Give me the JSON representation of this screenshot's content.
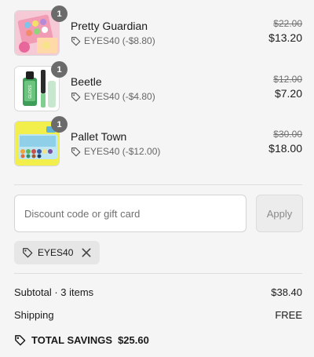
{
  "items": [
    {
      "name": "Pretty Guardian",
      "quantity": "1",
      "discount": "EYES40 (-$8.80)",
      "original_price": "$22.00",
      "final_price": "$13.20",
      "thumb_icon": "eyeshadow-palette-pink"
    },
    {
      "name": "Beetle",
      "quantity": "1",
      "discount": "EYES40 (-$4.80)",
      "original_price": "$12.00",
      "final_price": "$7.20",
      "thumb_icon": "lip-gloss-green"
    },
    {
      "name": "Pallet Town",
      "quantity": "1",
      "discount": "EYES40 (-$12.00)",
      "original_price": "$30.00",
      "final_price": "$18.00",
      "thumb_icon": "eyeshadow-palette-yellow"
    }
  ],
  "discount_form": {
    "placeholder": "Discount code or gift card",
    "value": "",
    "apply_label": "Apply"
  },
  "applied_code": {
    "code": "EYES40"
  },
  "summary": {
    "subtotal_label": "Subtotal · 3 items",
    "subtotal_value": "$38.40",
    "shipping_label": "Shipping",
    "shipping_value": "FREE",
    "savings_label": "TOTAL SAVINGS",
    "savings_value": "$25.60"
  },
  "colors": {
    "background": "#f5f5f5",
    "badge": "#6b6b6b",
    "chip": "#e6e6e6",
    "apply_disabled": "#ececec"
  }
}
